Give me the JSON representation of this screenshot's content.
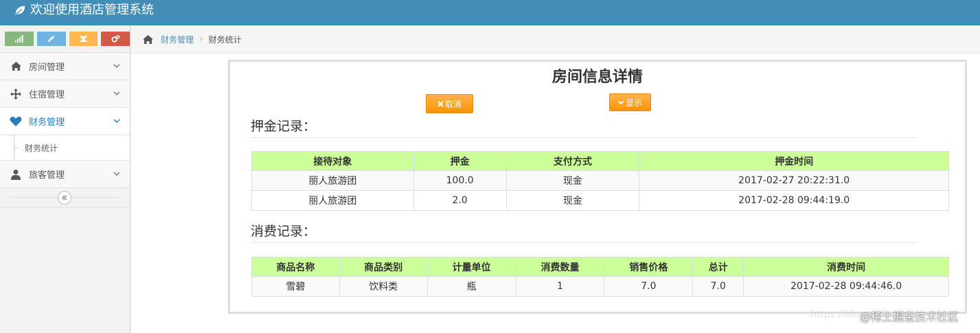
{
  "header": {
    "title": "欢迎使用酒店管理系统",
    "icon": "leaf-icon"
  },
  "shortcuts": [
    {
      "name": "signal-icon",
      "color": "#87b87f"
    },
    {
      "name": "pencil-icon",
      "color": "#6fb3e0"
    },
    {
      "name": "users-icon",
      "color": "#ffb752"
    },
    {
      "name": "cogs-icon",
      "color": "#d15b47"
    }
  ],
  "sidebar": {
    "items": [
      {
        "label": "房间管理",
        "icon": "home-icon"
      },
      {
        "label": "住宿管理",
        "icon": "move-icon"
      },
      {
        "label": "财务管理",
        "icon": "heart-icon"
      },
      {
        "label": "旅客管理",
        "icon": "user-icon"
      }
    ],
    "sub_items": [
      {
        "label": "财务统计"
      }
    ]
  },
  "breadcrumb": {
    "parent": "财务管理",
    "current": "财务统计"
  },
  "page": {
    "title": "房间信息详情",
    "cancel_label": "取消",
    "show_label": "显示",
    "deposit_section": "押金记录：",
    "consumption_section": "消费记录："
  },
  "deposit_table": {
    "headers": [
      "接待对象",
      "押金",
      "支付方式",
      "押金时间"
    ],
    "rows": [
      [
        "丽人旅游团",
        "100.0",
        "现金",
        "2017-02-27 20:22:31.0"
      ],
      [
        "丽人旅游团",
        "2.0",
        "现金",
        "2017-02-28 09:44:19.0"
      ]
    ]
  },
  "consumption_table": {
    "headers": [
      "商品名称",
      "商品类别",
      "计量单位",
      "消费数量",
      "销售价格",
      "总计",
      "消费时间"
    ],
    "rows": [
      [
        "雪碧",
        "饮料类",
        "瓶",
        "1",
        "7.0",
        "7.0",
        "2017-02-28 09:44:46.0"
      ]
    ]
  },
  "watermark": {
    "text": "@稀土掘金技术社区",
    "faint": "https://blog.csdn.net/..."
  },
  "colors": {
    "header": "#438eb9",
    "table_header": "#ccff99",
    "button": "#f89406",
    "link": "#4c8fbd"
  }
}
